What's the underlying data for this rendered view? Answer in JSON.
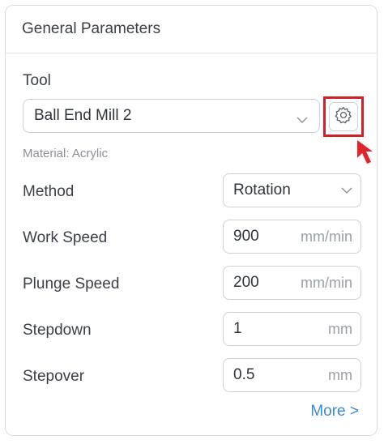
{
  "panel": {
    "title": "General Parameters"
  },
  "tool": {
    "label": "Tool",
    "selected": "Ball End Mill 2",
    "material_text": "Material: Acrylic"
  },
  "params": {
    "method": {
      "label": "Method",
      "value": "Rotation"
    },
    "work_speed": {
      "label": "Work Speed",
      "value": "900",
      "unit": "mm/min"
    },
    "plunge_speed": {
      "label": "Plunge Speed",
      "value": "200",
      "unit": "mm/min"
    },
    "stepdown": {
      "label": "Stepdown",
      "value": "1",
      "unit": "mm"
    },
    "stepover": {
      "label": "Stepover",
      "value": "0.5",
      "unit": "mm"
    }
  },
  "more_link": "More >",
  "colors": {
    "highlight": "#d0202a",
    "link": "#3b8ad9"
  },
  "icons": {
    "tool_settings": "gear-icon",
    "dropdown": "chevron-down-icon",
    "pointer": "red-arrow-icon"
  }
}
